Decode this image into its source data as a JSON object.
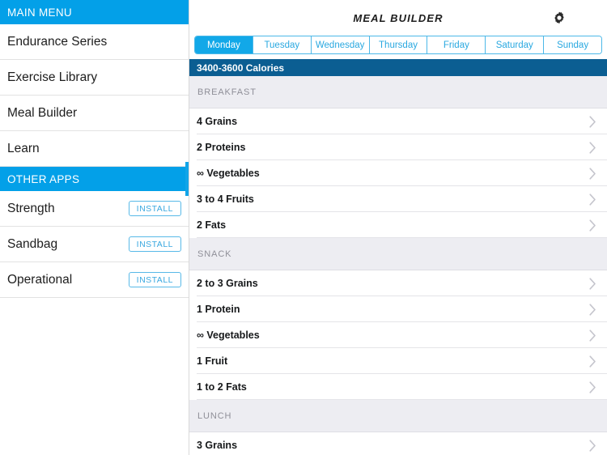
{
  "sidebar": {
    "main_menu_header": "MAIN MENU",
    "items": [
      {
        "label": "Endurance Series"
      },
      {
        "label": "Exercise Library"
      },
      {
        "label": "Meal Builder"
      },
      {
        "label": "Learn"
      }
    ],
    "other_apps_header": "OTHER APPS",
    "other_apps": [
      {
        "label": "Strength",
        "action": "INSTALL"
      },
      {
        "label": "Sandbag",
        "action": "INSTALL"
      },
      {
        "label": "Operational",
        "action": "INSTALL"
      }
    ]
  },
  "header": {
    "title": "MEAL BUILDER",
    "settings_icon": "gear-icon"
  },
  "tabs": [
    {
      "label": "Monday",
      "active": true
    },
    {
      "label": "Tuesday",
      "active": false
    },
    {
      "label": "Wednesday",
      "active": false
    },
    {
      "label": "Thursday",
      "active": false
    },
    {
      "label": "Friday",
      "active": false
    },
    {
      "label": "Saturday",
      "active": false
    },
    {
      "label": "Sunday",
      "active": false
    }
  ],
  "calorie_bar": "3400-3600 Calories",
  "sections": [
    {
      "title": "BREAKFAST",
      "rows": [
        {
          "label": "4 Grains"
        },
        {
          "label": "2 Proteins"
        },
        {
          "label": "∞ Vegetables"
        },
        {
          "label": "3 to 4 Fruits"
        },
        {
          "label": "2 Fats"
        }
      ]
    },
    {
      "title": "SNACK",
      "rows": [
        {
          "label": "2 to 3 Grains"
        },
        {
          "label": "1 Protein"
        },
        {
          "label": "∞ Vegetables"
        },
        {
          "label": "1 Fruit"
        },
        {
          "label": "1 to 2 Fats"
        }
      ]
    },
    {
      "title": "LUNCH",
      "rows": [
        {
          "label": "3 Grains"
        }
      ]
    }
  ],
  "colors": {
    "accent_blue": "#03a0e8",
    "tab_active": "#12a8e8",
    "calorie_bar": "#0b5e92",
    "section_bg": "#ededf2"
  }
}
